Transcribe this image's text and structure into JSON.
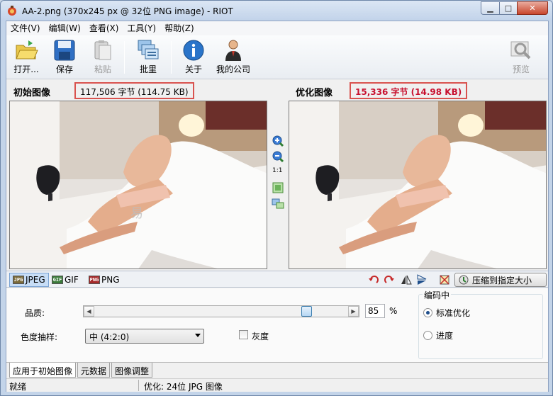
{
  "window": {
    "title": "AA-2.png (370x245 px @ 32位 PNG image) - RIOT"
  },
  "menu": [
    "文件(V)",
    "编辑(W)",
    "查看(X)",
    "工具(Y)",
    "帮助(Z)"
  ],
  "toolbar": {
    "open": "打开...",
    "save": "保存",
    "paste": "粘贴",
    "batch": "批里",
    "about": "关于",
    "company": "我的公司",
    "preview": "预览"
  },
  "original": {
    "label": "初始图像",
    "size": "117,506 字节 (114.75 KB)"
  },
  "optimized": {
    "label": "优化图像",
    "size": "15,336 字节 (14.98 KB)"
  },
  "zoom_label": "1:1",
  "formats": [
    "JPEG",
    "GIF",
    "PNG"
  ],
  "compress_button": "压缩到指定大小",
  "settings": {
    "quality_label": "品质:",
    "quality_value": "85",
    "quality_fraction": 0.85,
    "percent": "%",
    "subsampling_label": "色度抽样:",
    "subsampling_value": "中 (4:2:0)",
    "grayscale_label": "灰度",
    "encoding_group": "编码中",
    "encoding_standard": "标准优化",
    "encoding_progressive": "进度"
  },
  "bottom_tabs": [
    "应用于初始图像",
    "元数据",
    "图像调整"
  ],
  "status": {
    "left": "就绪",
    "right": "优化: 24位 JPG 图像"
  },
  "colors": {
    "highlight_border": "#d9534f",
    "optimized_size_text": "#c8102e"
  }
}
